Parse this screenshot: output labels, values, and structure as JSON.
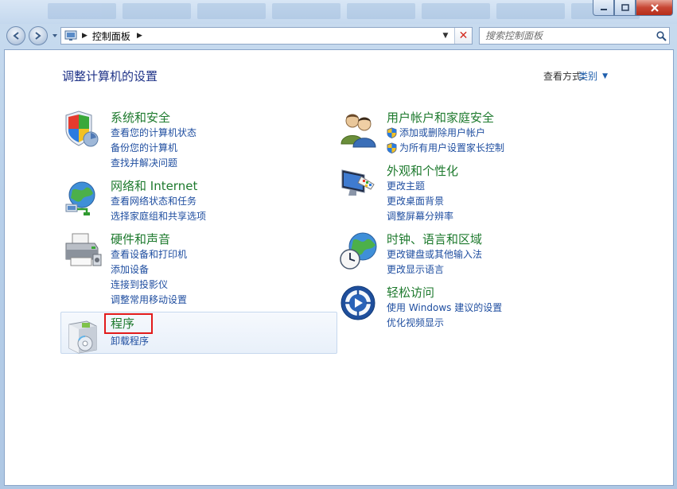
{
  "window": {
    "min_label": "minimize",
    "max_label": "maximize",
    "close_label": "close"
  },
  "nav": {
    "address_text": "控制面板",
    "search_placeholder": "搜索控制面板"
  },
  "header": {
    "title": "调整计算机的设置",
    "viewby_label": "查看方式:",
    "viewby_value": "类别"
  },
  "categories": {
    "system": {
      "title": "系统和安全",
      "links": [
        "查看您的计算机状态",
        "备份您的计算机",
        "查找并解决问题"
      ],
      "icon": "shield-icon"
    },
    "network": {
      "title": "网络和 Internet",
      "links": [
        "查看网络状态和任务",
        "选择家庭组和共享选项"
      ],
      "icon": "network-globe-icon"
    },
    "hardware": {
      "title": "硬件和声音",
      "links": [
        "查看设备和打印机",
        "添加设备",
        "连接到投影仪",
        "调整常用移动设置"
      ],
      "icon": "printer-icon"
    },
    "programs": {
      "title": "程序",
      "links": [
        "卸载程序"
      ],
      "icon": "programs-box-icon"
    },
    "users": {
      "title": "用户帐户和家庭安全",
      "links": [
        "添加或删除用户帐户",
        "为所有用户设置家长控制"
      ],
      "icon": "users-icon"
    },
    "appearance": {
      "title": "外观和个性化",
      "links": [
        "更改主题",
        "更改桌面背景",
        "调整屏幕分辨率"
      ],
      "icon": "monitor-palette-icon"
    },
    "clock": {
      "title": "时钟、语言和区域",
      "links": [
        "更改键盘或其他输入法",
        "更改显示语言"
      ],
      "icon": "clock-globe-icon"
    },
    "ease": {
      "title": "轻松访问",
      "links": [
        "使用 Windows 建议的设置",
        "优化视频显示"
      ],
      "icon": "ease-of-access-icon"
    }
  },
  "colors": {
    "category_title": "#1e7a2e",
    "link": "#1f4ea0",
    "highlight_box": "#e21b1b"
  }
}
